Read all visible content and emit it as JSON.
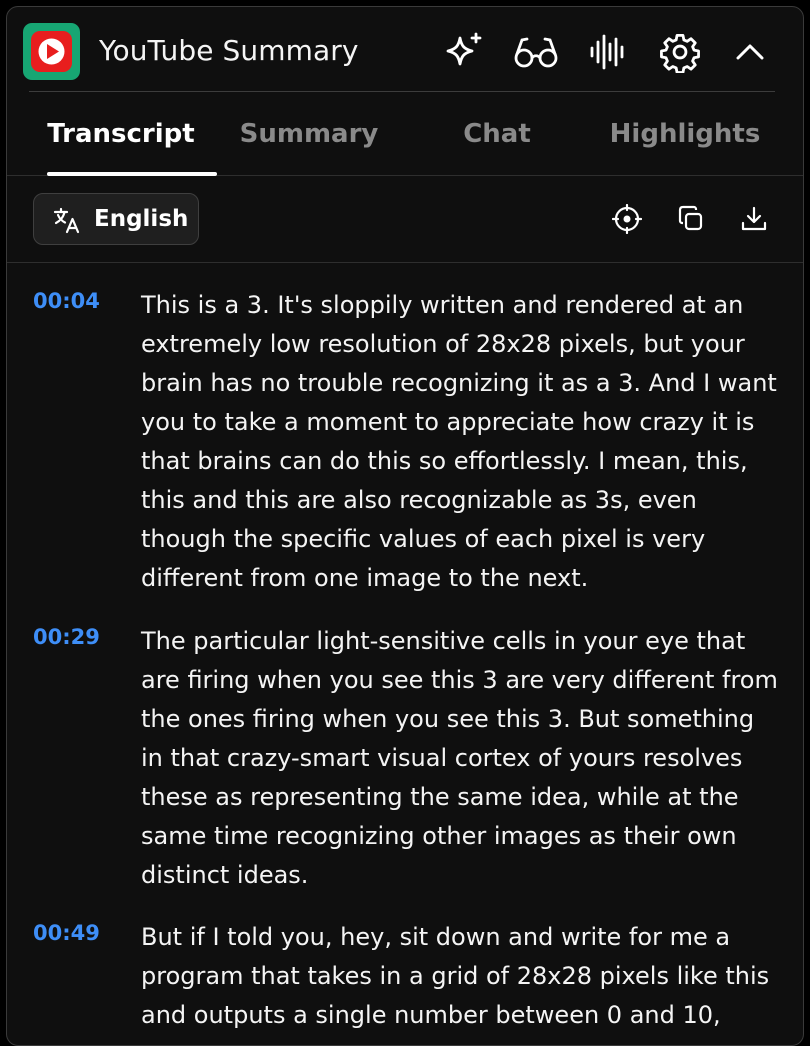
{
  "header": {
    "title": "YouTube Summary",
    "icons": [
      "sparkles-icon",
      "glasses-icon",
      "audio-wave-icon",
      "gear-icon",
      "chevron-up-icon"
    ],
    "logo_color": "#17a673",
    "logo_accent": "#e81e1e"
  },
  "tabs": [
    {
      "label": "Transcript",
      "active": true
    },
    {
      "label": "Summary",
      "active": false
    },
    {
      "label": "Chat",
      "active": false
    },
    {
      "label": "Highlights",
      "active": false
    }
  ],
  "toolbar": {
    "language_label": "English",
    "icons": [
      "crosshair-icon",
      "copy-icon",
      "download-icon"
    ]
  },
  "transcript": [
    {
      "time": "00:04",
      "text": "This is a 3. It's sloppily written and rendered at an extremely low resolution of 28x28 pixels, but your brain has no trouble recognizing it as a 3. And I want you to take a moment to appreciate how crazy it is that brains can do this so effortlessly. I mean, this, this and this are also recognizable as 3s, even though the specific values of each pixel is very different from one image to the next."
    },
    {
      "time": "00:29",
      "text": "The particular light-sensitive cells in your eye that are firing when you see this 3 are very different from the ones firing when you see this 3. But something in that crazy-smart visual cortex of yours resolves these as representing the same idea, while at the same time recognizing other images as their own distinct ideas."
    },
    {
      "time": "00:49",
      "text": "But if I told you, hey, sit down and write for me a program that takes in a grid of 28x28 pixels like this and outputs a single number between 0 and 10,"
    }
  ],
  "colors": {
    "timestamp": "#3e8ef7",
    "background": "#0f0f0f",
    "active_tab": "#ffffff",
    "inactive_tab": "#8a8a8a"
  }
}
